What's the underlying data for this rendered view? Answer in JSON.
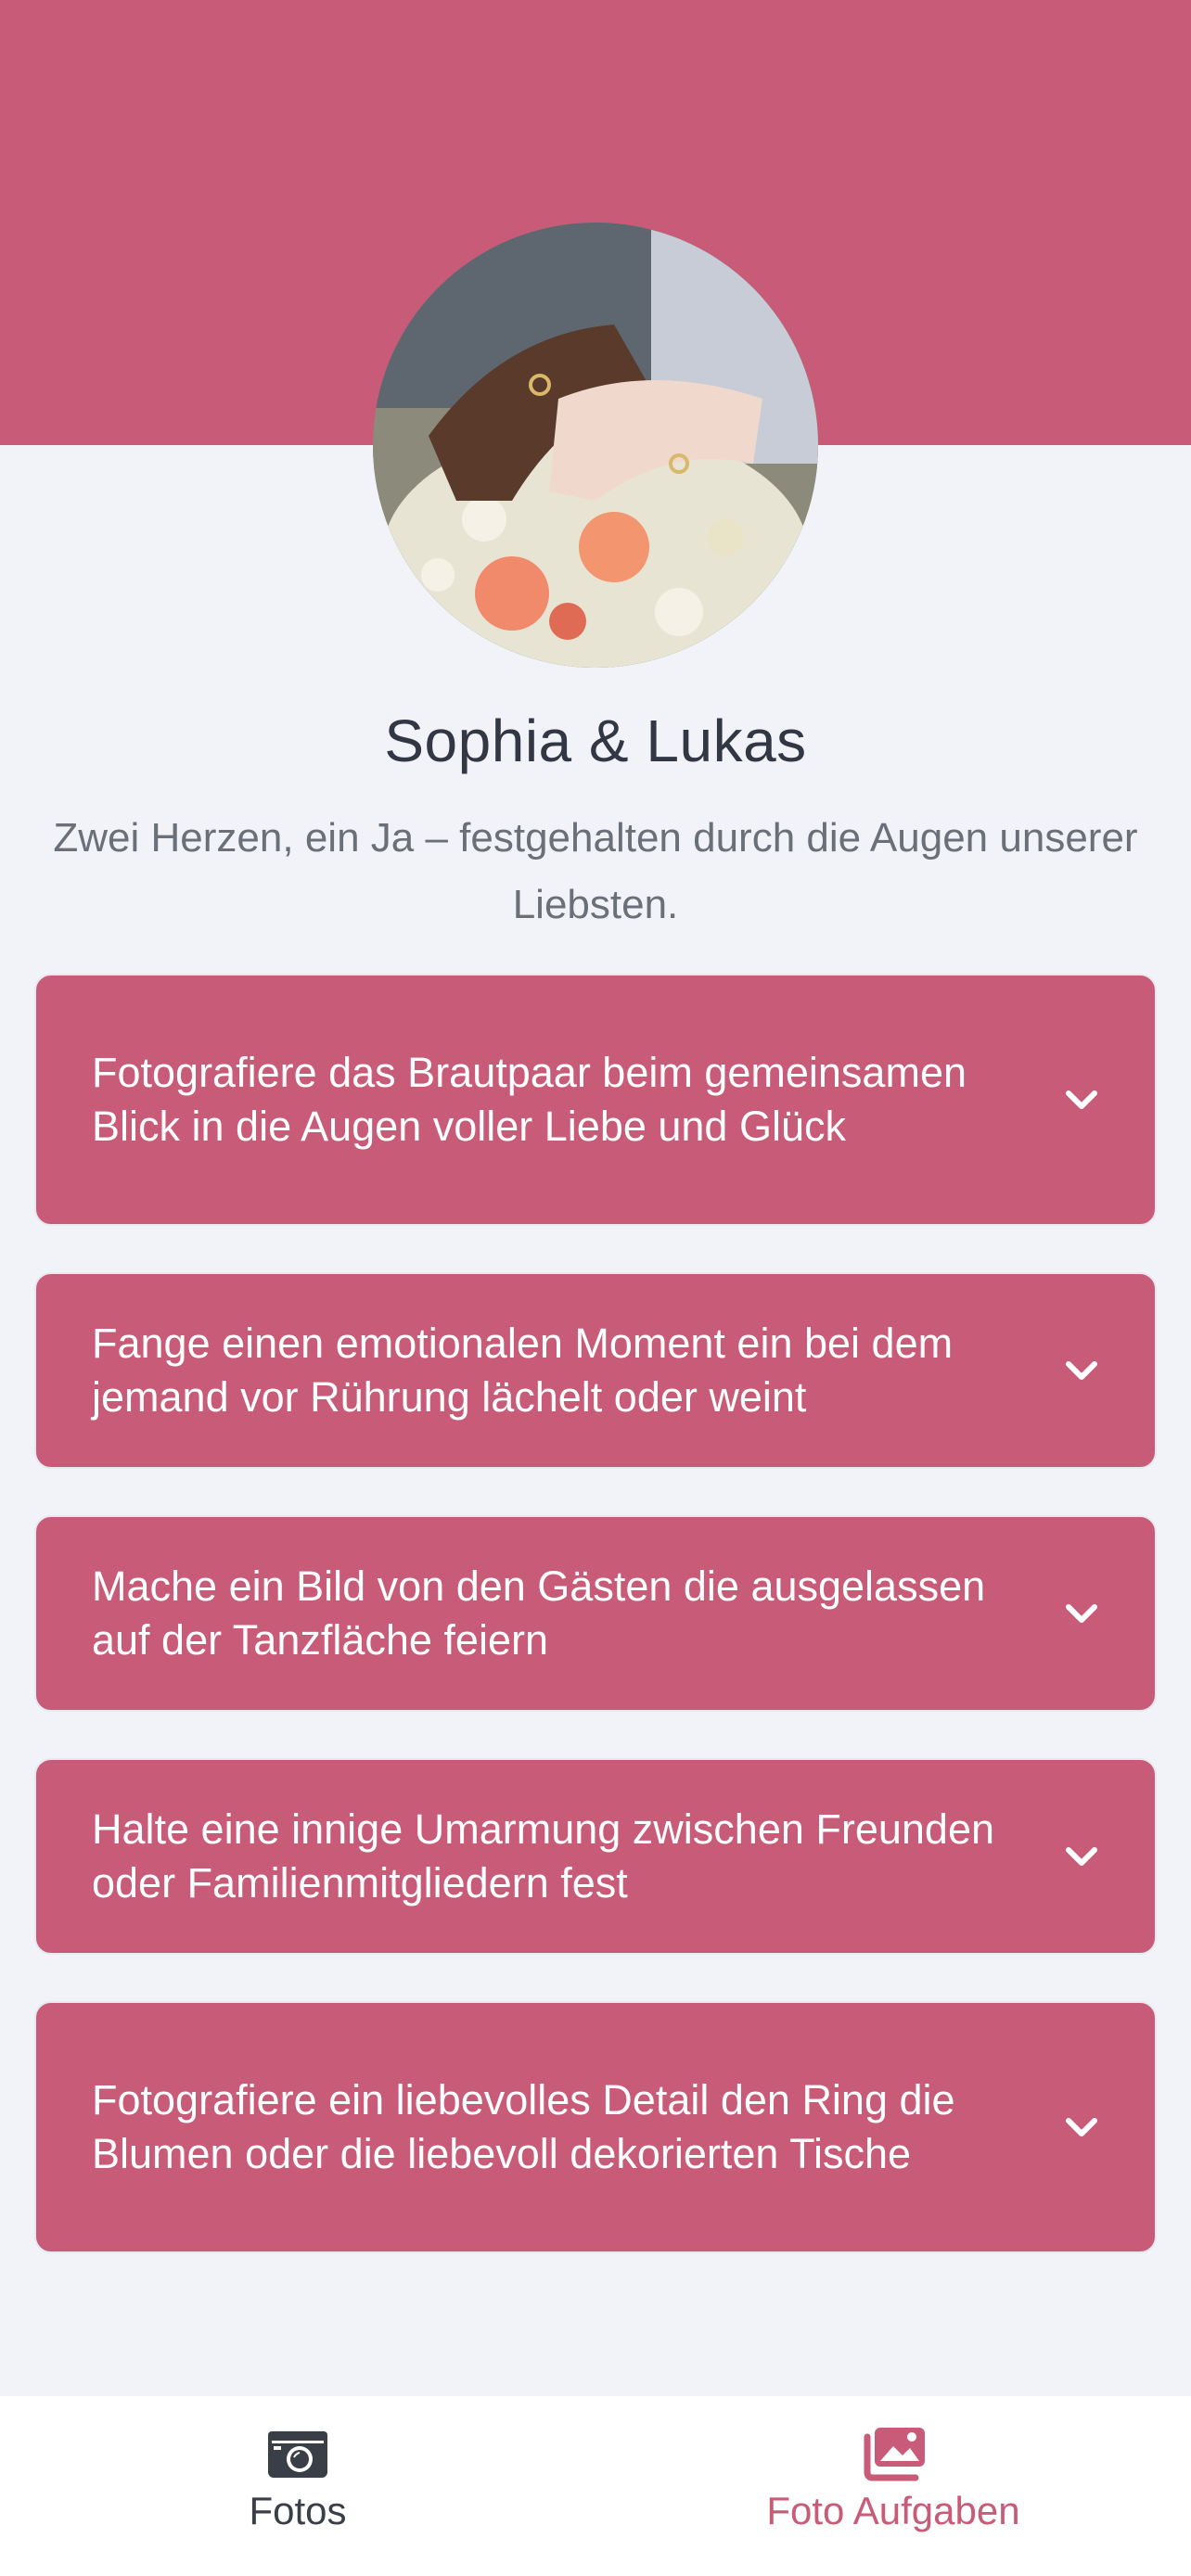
{
  "profile": {
    "couple_name": "Sophia & Lukas",
    "tagline": "Zwei Herzen, ein Ja – festgehalten durch die Augen unserer Liebsten.",
    "avatar_icon": "wedding-photo"
  },
  "tasks": [
    {
      "text": "Fotografiere das Brautpaar beim gemeinsamen Blick in die Augen voller Liebe und Glück",
      "icon": "chevron-down-icon"
    },
    {
      "text": "Fange einen emotionalen Moment ein bei dem jemand vor Rührung lächelt oder weint",
      "icon": "chevron-down-icon"
    },
    {
      "text": "Mache ein Bild von den Gästen die ausgelassen auf der Tanzfläche feiern",
      "icon": "chevron-down-icon"
    },
    {
      "text": "Halte eine innige Umarmung zwischen Freunden oder Familienmitgliedern fest",
      "icon": "chevron-down-icon"
    },
    {
      "text": "Fotografiere ein liebevolles Detail den Ring die Blumen oder die liebevoll dekorierten Tische",
      "icon": "chevron-down-icon"
    }
  ],
  "nav": {
    "fotos": {
      "label": "Fotos",
      "icon": "camera-icon"
    },
    "aufgaben": {
      "label": "Foto Aufgaben",
      "icon": "images-icon",
      "active": true
    }
  },
  "colors": {
    "brand": "#c85b77",
    "background": "#f1f3f9",
    "nav_inactive": "#3a3e47"
  }
}
